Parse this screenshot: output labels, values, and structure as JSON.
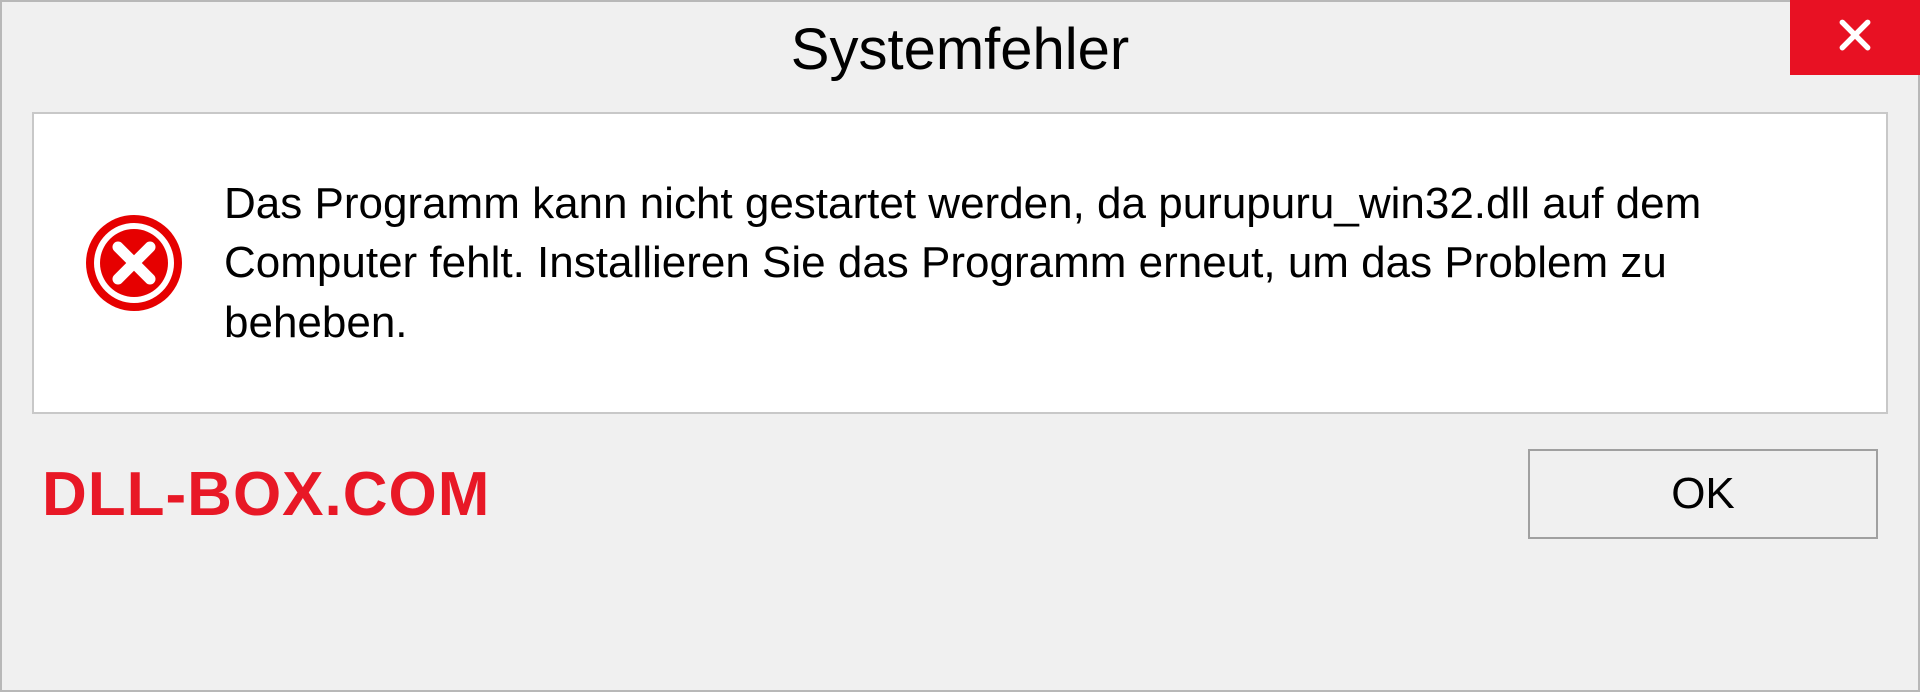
{
  "dialog": {
    "title": "Systemfehler",
    "message": "Das Programm kann nicht gestartet werden, da purupuru_win32.dll auf dem Computer fehlt. Installieren Sie das Programm erneut, um das Problem zu beheben.",
    "ok_label": "OK"
  },
  "watermark": "DLL-BOX.COM",
  "colors": {
    "close_btn": "#e81123",
    "error_icon": "#e60000",
    "watermark": "#e81826"
  }
}
